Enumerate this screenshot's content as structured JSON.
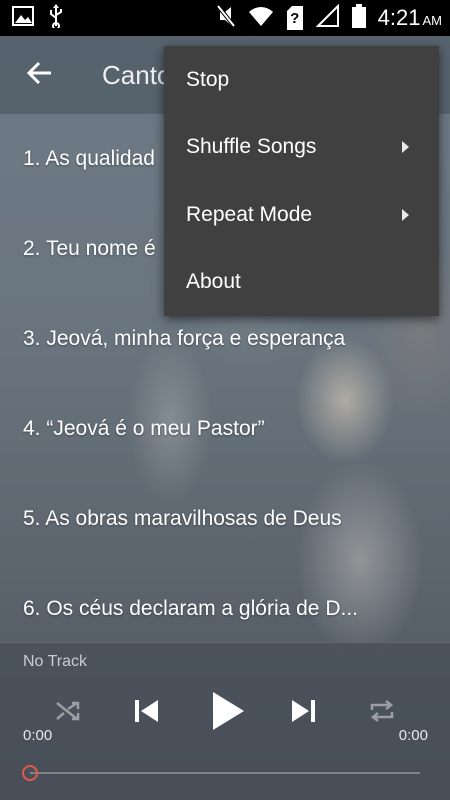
{
  "status_bar": {
    "icons": [
      "image-icon",
      "usb-icon",
      "mute-icon",
      "wifi-icon",
      "sim-icon",
      "signal-icon",
      "battery-icon"
    ],
    "sim_label": "?",
    "time": "4:21",
    "ampm": "AM"
  },
  "toolbar": {
    "back_icon": "arrow-back-icon",
    "title": "Canto"
  },
  "songs": [
    "1. As qualidad",
    "2. Teu nome é",
    "3. Jeová, minha força e esperança",
    "4. “Jeová é o meu Pastor”",
    "5. As obras maravilhosas de Deus",
    "6. Os céus declaram a glória de D..."
  ],
  "menu": {
    "items": [
      {
        "label": "Stop",
        "has_submenu": false
      },
      {
        "label": "Shuffle Songs",
        "has_submenu": true
      },
      {
        "label": "Repeat Mode",
        "has_submenu": true
      },
      {
        "label": "About",
        "has_submenu": false
      }
    ]
  },
  "player": {
    "track_name": "No Track",
    "time_start": "0:00",
    "time_end": "0:00",
    "progress": 0,
    "controls": [
      "shuffle-icon",
      "previous-icon",
      "play-icon",
      "next-icon",
      "repeat-icon"
    ]
  },
  "colors": {
    "menu_bg": "#404040",
    "seek_thumb": "#e05a4a"
  }
}
